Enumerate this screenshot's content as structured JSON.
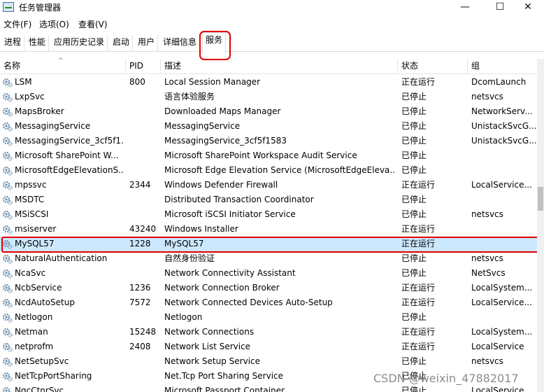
{
  "window": {
    "title": "任务管理器",
    "minimize": "—",
    "maximize": "☐",
    "close": "✕"
  },
  "menu": [
    "文件(F)",
    "选项(O)",
    "查看(V)"
  ],
  "tabs": [
    "进程",
    "性能",
    "应用历史记录",
    "启动",
    "用户",
    "详细信息",
    "服务"
  ],
  "active_tab": "服务",
  "columns": {
    "name": "名称",
    "pid": "PID",
    "desc": "描述",
    "status": "状态",
    "group": "组"
  },
  "services": [
    {
      "name": "LSM",
      "pid": "800",
      "desc": "Local Session Manager",
      "status": "正在运行",
      "group": "DcomLaunch"
    },
    {
      "name": "LxpSvc",
      "pid": "",
      "desc": "语言体验服务",
      "status": "已停止",
      "group": "netsvcs"
    },
    {
      "name": "MapsBroker",
      "pid": "",
      "desc": "Downloaded Maps Manager",
      "status": "已停止",
      "group": "NetworkServ..."
    },
    {
      "name": "MessagingService",
      "pid": "",
      "desc": "MessagingService",
      "status": "已停止",
      "group": "UnistackSvcG..."
    },
    {
      "name": "MessagingService_3cf5f1...",
      "pid": "",
      "desc": "MessagingService_3cf5f1583",
      "status": "已停止",
      "group": "UnistackSvcG..."
    },
    {
      "name": "Microsoft SharePoint W...",
      "pid": "",
      "desc": "Microsoft SharePoint Workspace Audit Service",
      "status": "已停止",
      "group": ""
    },
    {
      "name": "MicrosoftEdgeElevationS...",
      "pid": "",
      "desc": "Microsoft Edge Elevation Service (MicrosoftEdgeEleva...",
      "status": "已停止",
      "group": ""
    },
    {
      "name": "mpssvc",
      "pid": "2344",
      "desc": "Windows Defender Firewall",
      "status": "正在运行",
      "group": "LocalService..."
    },
    {
      "name": "MSDTC",
      "pid": "",
      "desc": "Distributed Transaction Coordinator",
      "status": "已停止",
      "group": ""
    },
    {
      "name": "MSiSCSI",
      "pid": "",
      "desc": "Microsoft iSCSI Initiator Service",
      "status": "已停止",
      "group": "netsvcs"
    },
    {
      "name": "msiserver",
      "pid": "43240",
      "desc": "Windows Installer",
      "status": "正在运行",
      "group": ""
    },
    {
      "name": "MySQL57",
      "pid": "1228",
      "desc": "MySQL57",
      "status": "正在运行",
      "group": ""
    },
    {
      "name": "NaturalAuthentication",
      "pid": "",
      "desc": "自然身份验证",
      "status": "已停止",
      "group": "netsvcs"
    },
    {
      "name": "NcaSvc",
      "pid": "",
      "desc": "Network Connectivity Assistant",
      "status": "已停止",
      "group": "NetSvcs"
    },
    {
      "name": "NcbService",
      "pid": "1236",
      "desc": "Network Connection Broker",
      "status": "正在运行",
      "group": "LocalSystem..."
    },
    {
      "name": "NcdAutoSetup",
      "pid": "7572",
      "desc": "Network Connected Devices Auto-Setup",
      "status": "正在运行",
      "group": "LocalService..."
    },
    {
      "name": "Netlogon",
      "pid": "",
      "desc": "Netlogon",
      "status": "已停止",
      "group": ""
    },
    {
      "name": "Netman",
      "pid": "15248",
      "desc": "Network Connections",
      "status": "正在运行",
      "group": "LocalSystem..."
    },
    {
      "name": "netprofm",
      "pid": "2408",
      "desc": "Network List Service",
      "status": "正在运行",
      "group": "LocalService"
    },
    {
      "name": "NetSetupSvc",
      "pid": "",
      "desc": "Network Setup Service",
      "status": "已停止",
      "group": "netsvcs"
    },
    {
      "name": "NetTcpPortSharing",
      "pid": "",
      "desc": "Net.Tcp Port Sharing Service",
      "status": "已停止",
      "group": ""
    },
    {
      "name": "NgcCtnrSvc",
      "pid": "",
      "desc": "Microsoft Passport Container",
      "status": "已停止",
      "group": "LocalService..."
    }
  ],
  "selected_service": "MySQL57",
  "watermark": "CSDN @weixin_47882017",
  "colors": {
    "selection": "#cce8ff",
    "highlight": "#e00000"
  }
}
